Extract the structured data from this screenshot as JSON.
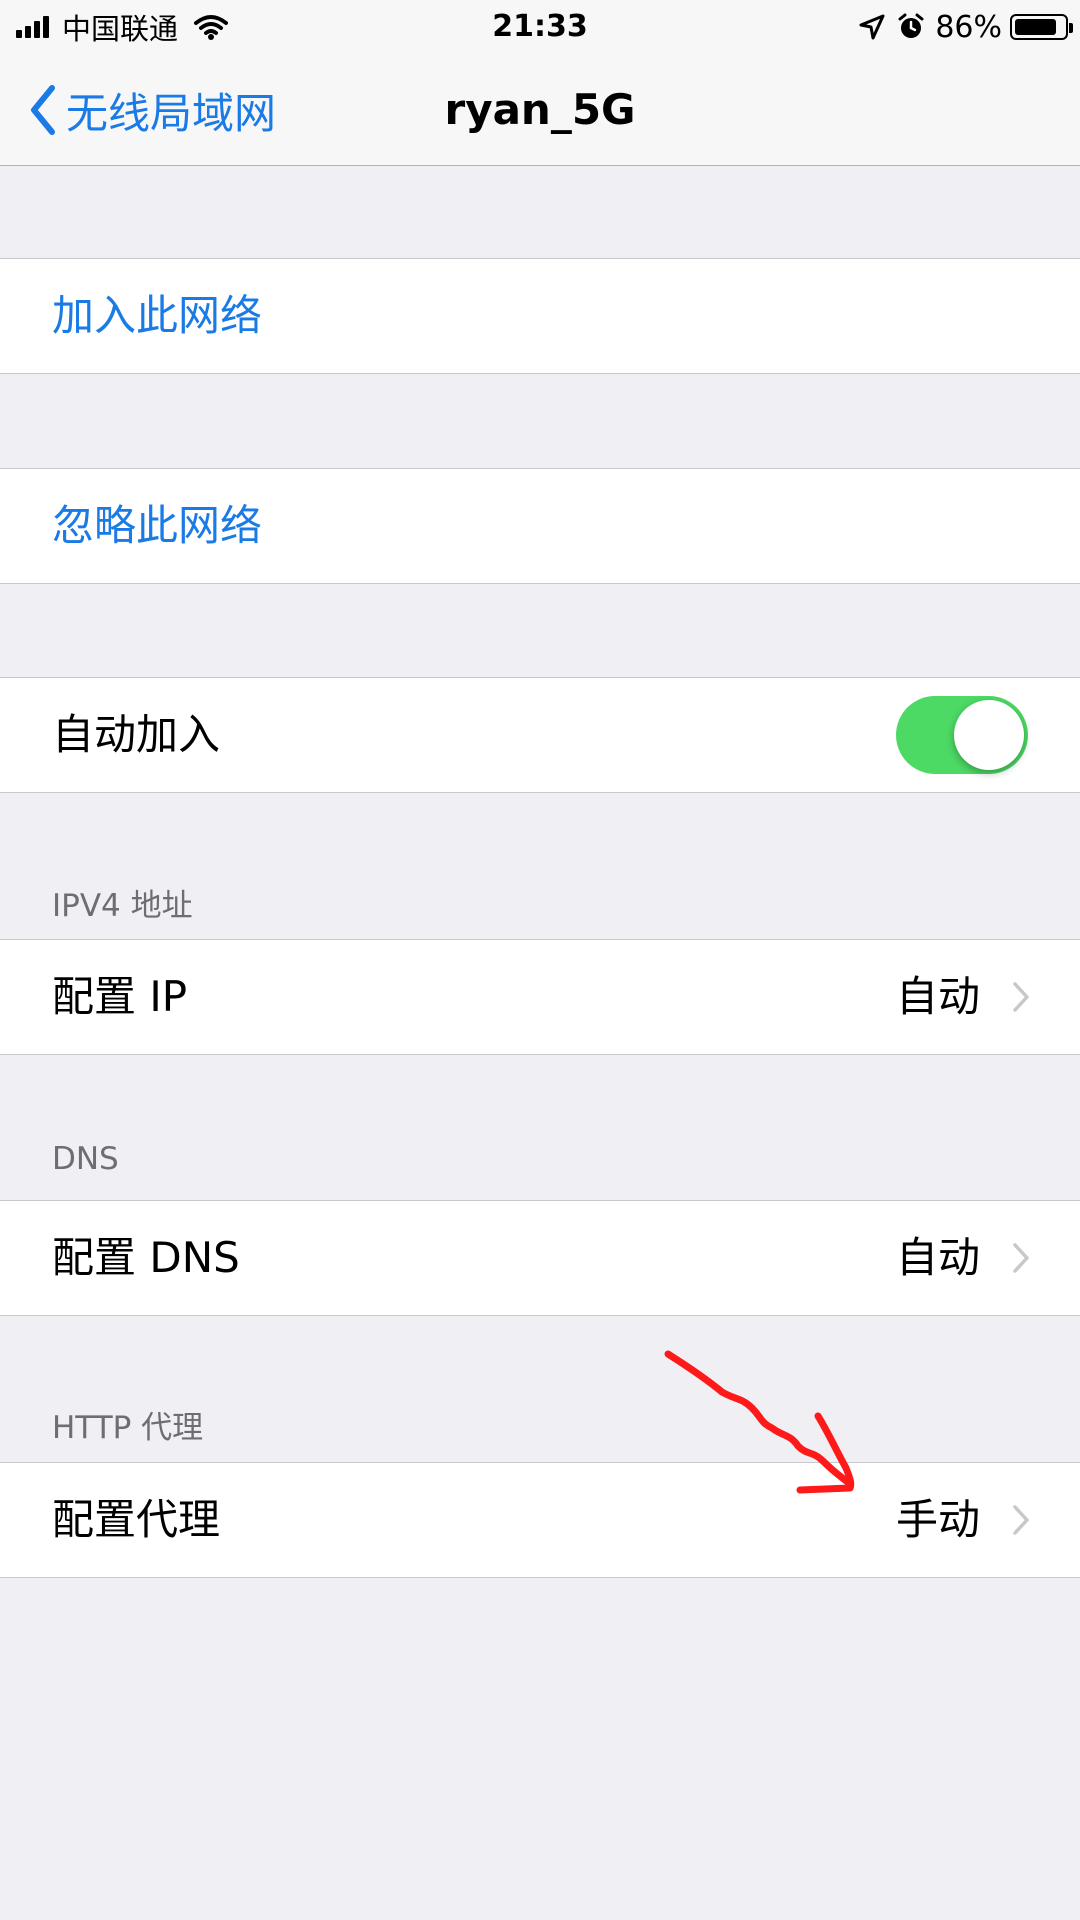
{
  "status_bar": {
    "carrier": "中国联通",
    "time": "21:33",
    "battery_percent": "86%",
    "battery_level": 0.86,
    "icons": [
      "signal-icon",
      "wifi-icon",
      "location-arrow-icon",
      "alarm-icon",
      "battery-icon"
    ]
  },
  "nav": {
    "back_label": "无线局域网",
    "title": "ryan_5G"
  },
  "actions": {
    "join": "加入此网络",
    "forget": "忽略此网络"
  },
  "auto_join": {
    "label": "自动加入",
    "enabled": true
  },
  "ipv4": {
    "header": "IPV4 地址",
    "label": "配置 IP",
    "value": "自动"
  },
  "dns": {
    "header": "DNS",
    "label": "配置 DNS",
    "value": "自动"
  },
  "http_proxy": {
    "header": "HTTP 代理",
    "label": "配置代理",
    "value": "手动"
  },
  "colors": {
    "accent": "#1a7ae6",
    "toggle_on": "#4cd964",
    "background": "#efeff4",
    "annotation": "#ff1a1a"
  }
}
